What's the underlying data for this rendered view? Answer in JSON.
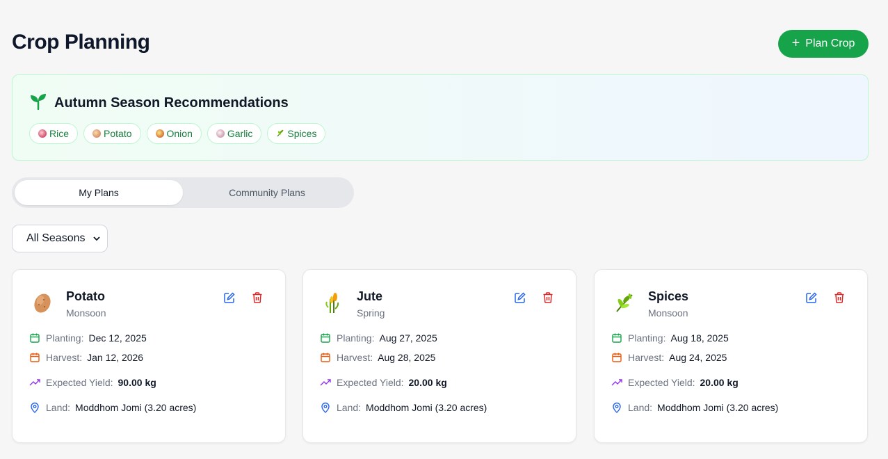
{
  "header": {
    "title": "Crop Planning",
    "plan_button_label": "Plan Crop"
  },
  "recommendations": {
    "title": "Autumn Season Recommendations",
    "chips": [
      "Rice",
      "Potato",
      "Onion",
      "Garlic",
      "Spices"
    ]
  },
  "tabs": [
    {
      "label": "My Plans",
      "active": true
    },
    {
      "label": "Community Plans",
      "active": false
    }
  ],
  "filter": {
    "selected": "All Seasons"
  },
  "labels": {
    "planting": "Planting:",
    "harvest": "Harvest:",
    "expected_yield": "Expected Yield:",
    "land": "Land:"
  },
  "plans": [
    {
      "crop": "Potato",
      "season": "Monsoon",
      "planting": "Dec 12, 2025",
      "harvest": "Jan 12, 2026",
      "expected_yield": "90.00 kg",
      "land": "Moddhom Jomi (3.20 acres)",
      "icon": "potato-icon"
    },
    {
      "crop": "Jute",
      "season": "Spring",
      "planting": "Aug 27, 2025",
      "harvest": "Aug 28, 2025",
      "expected_yield": "20.00 kg",
      "land": "Moddhom Jomi (3.20 acres)",
      "icon": "jute-icon"
    },
    {
      "crop": "Spices",
      "season": "Monsoon",
      "planting": "Aug 18, 2025",
      "harvest": "Aug 24, 2025",
      "expected_yield": "20.00 kg",
      "land": "Moddhom Jomi (3.20 acres)",
      "icon": "herb-icon"
    }
  ],
  "colors": {
    "primary": "#16a34a",
    "danger": "#dc2626",
    "edit": "#2563eb",
    "harvest": "#ea580c",
    "yield": "#9333ea",
    "land": "#2563eb"
  }
}
